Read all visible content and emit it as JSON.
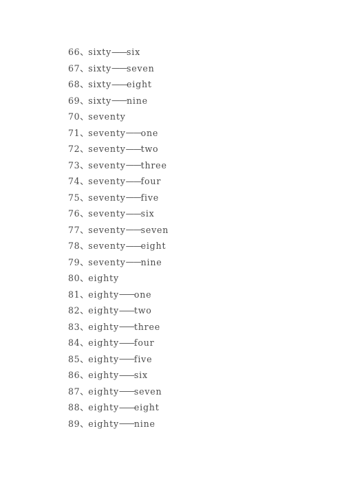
{
  "document": {
    "background_color": "#ffffff",
    "text_color": "#4b4b4b",
    "number_separator": "、",
    "word_separator": "——",
    "lines": [
      {
        "number": "66",
        "sep": "、",
        "word": "sixty",
        "dash": "——",
        "suffix": "six",
        "text": "66、sixty——six"
      },
      {
        "number": "67",
        "sep": "、",
        "word": "sixty",
        "dash": "——",
        "suffix": "seven",
        "text": "67、sixty——seven"
      },
      {
        "number": "68",
        "sep": "、",
        "word": "sixty",
        "dash": "——",
        "suffix": "eight",
        "text": "68、sixty——eight"
      },
      {
        "number": "69",
        "sep": "、",
        "word": "sixty",
        "dash": "——",
        "suffix": "nine",
        "text": "69、sixty——nine"
      },
      {
        "number": "70",
        "sep": "、",
        "word": "seventy",
        "dash": "",
        "suffix": "",
        "text": "70、seventy"
      },
      {
        "number": "71",
        "sep": "、",
        "word": "seventy",
        "dash": "——",
        "suffix": "one",
        "text": "71、seventy——one"
      },
      {
        "number": "72",
        "sep": "、",
        "word": "seventy",
        "dash": "——",
        "suffix": "two",
        "text": "72、seventy——two"
      },
      {
        "number": "73",
        "sep": "、",
        "word": "seventy",
        "dash": "——",
        "suffix": "three",
        "text": "73、seventy——three"
      },
      {
        "number": "74",
        "sep": "、",
        "word": "seventy",
        "dash": "——",
        "suffix": "four",
        "text": "74、seventy——four"
      },
      {
        "number": "75",
        "sep": "、",
        "word": "seventy",
        "dash": "——",
        "suffix": "five",
        "text": "75、seventy——five"
      },
      {
        "number": "76",
        "sep": "、",
        "word": "seventy",
        "dash": "——",
        "suffix": "six",
        "text": "76、seventy——six"
      },
      {
        "number": "77",
        "sep": "、",
        "word": "seventy",
        "dash": "——",
        "suffix": "seven",
        "text": "77、seventy——seven"
      },
      {
        "number": "78",
        "sep": "、",
        "word": "seventy",
        "dash": "——",
        "suffix": "eight",
        "text": "78、seventy——eight"
      },
      {
        "number": "79",
        "sep": "、",
        "word": "seventy",
        "dash": "——",
        "suffix": "nine",
        "text": "79、seventy——nine"
      },
      {
        "number": "80",
        "sep": "、",
        "word": "eighty",
        "dash": "",
        "suffix": "",
        "text": "80、eighty"
      },
      {
        "number": "81",
        "sep": "、",
        "word": "eighty",
        "dash": "——",
        "suffix": "one",
        "text": "81、eighty——one"
      },
      {
        "number": "82",
        "sep": "、",
        "word": "eighty",
        "dash": "——",
        "suffix": "two",
        "text": "82、eighty——two"
      },
      {
        "number": "83",
        "sep": "、",
        "word": "eighty",
        "dash": "——",
        "suffix": "three",
        "text": "83、eighty——three"
      },
      {
        "number": "84",
        "sep": "、",
        "word": "eighty",
        "dash": "——",
        "suffix": "four",
        "text": "84、eighty——four"
      },
      {
        "number": "85",
        "sep": "、",
        "word": "eighty",
        "dash": "——",
        "suffix": "five",
        "text": "85、eighty——five"
      },
      {
        "number": "86",
        "sep": "、",
        "word": "eighty",
        "dash": "——",
        "suffix": "six",
        "text": "86、eighty——six"
      },
      {
        "number": "87",
        "sep": "、",
        "word": "eighty",
        "dash": "——",
        "suffix": "seven",
        "text": "87、eighty——seven"
      },
      {
        "number": "88",
        "sep": "、",
        "word": "eighty",
        "dash": "——",
        "suffix": "eight",
        "text": "88、eighty——eight"
      },
      {
        "number": "89",
        "sep": "、",
        "word": "eighty",
        "dash": "——",
        "suffix": "nine",
        "text": "89、eighty——nine"
      }
    ]
  }
}
